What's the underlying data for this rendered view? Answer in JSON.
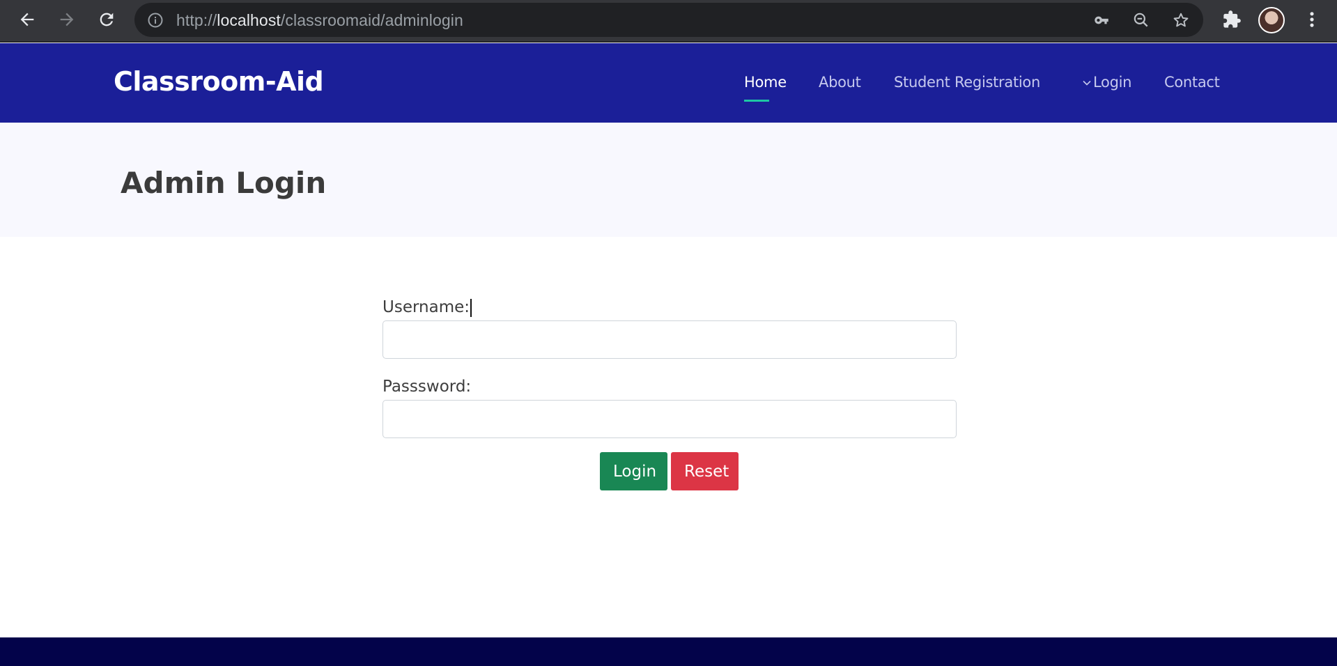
{
  "browser": {
    "url_scheme": "http://",
    "url_host": "localhost",
    "url_path": "/classroomaid/adminlogin",
    "icons": [
      "back-arrow-icon",
      "forward-arrow-icon",
      "reload-icon",
      "info-icon",
      "key-icon",
      "zoom-out-icon",
      "star-icon",
      "puzzle-icon",
      "kebab-menu-icon"
    ]
  },
  "header": {
    "brand": "Classroom-Aid",
    "menu": {
      "home": "Home",
      "about": "About",
      "student_registration": "Student Registration",
      "login": "Login",
      "contact": "Contact"
    }
  },
  "page": {
    "title": "Admin Login"
  },
  "form": {
    "username_label": "Username:",
    "username_value": "",
    "password_label": "Passsword:",
    "password_value": "",
    "login_label": "Login",
    "reset_label": "Reset"
  },
  "colors": {
    "header_bg": "#1b1f98",
    "active_underline": "#1ec7a4",
    "login_button": "#198754",
    "reset_button": "#dc3545",
    "footer_bg": "#03034a"
  }
}
